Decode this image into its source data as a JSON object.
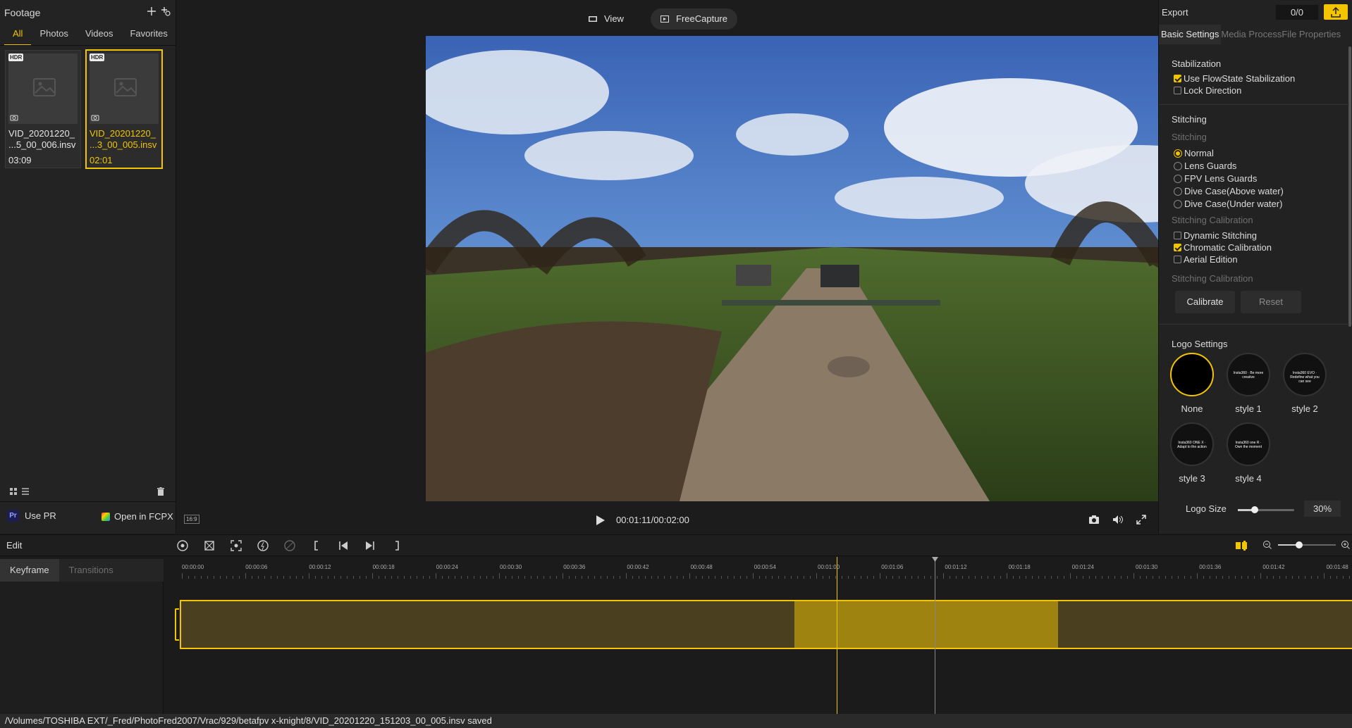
{
  "footage": {
    "title": "Footage",
    "tabs": [
      "All",
      "Photos",
      "Videos",
      "Favorites"
    ],
    "active_tab": "All",
    "items": [
      {
        "badge": "HDR",
        "name": "VID_20201220_\n...5_00_006.insv",
        "duration": "03:09",
        "selected": false
      },
      {
        "badge": "HDR",
        "name": "VID_20201220_\n...3_00_005.insv",
        "duration": "02:01",
        "selected": true
      }
    ],
    "use_pr": "Use PR",
    "pr_badge": "Pr",
    "open_fcpx": "Open in FCPX"
  },
  "viewer": {
    "view_label": "View",
    "freecapture_label": "FreeCapture",
    "aspect_badge": "16:9",
    "timecode": "00:01:11/00:02:00"
  },
  "export": {
    "title": "Export",
    "counter": "0/0",
    "tabs": [
      "Basic Settings",
      "Media Process",
      "File Properties"
    ],
    "stabilization": {
      "title": "Stabilization",
      "use_flowstate": "Use FlowState Stabilization",
      "lock_direction": "Lock Direction"
    },
    "stitching": {
      "title": "Stitching",
      "subtitle": "Stitching",
      "options": [
        "Normal",
        "Lens Guards",
        "FPV Lens Guards",
        "Dive Case(Above water)",
        "Dive Case(Under water)"
      ],
      "selected": "Normal"
    },
    "calibration": {
      "title": "Stitching Calibration",
      "dynamic": "Dynamic Stitching",
      "chromatic": "Chromatic Calibration",
      "aerial": "Aerial Edition",
      "title2": "Stitching Calibration",
      "calibrate": "Calibrate",
      "reset": "Reset"
    },
    "logo": {
      "title": "Logo Settings",
      "styles": [
        "None",
        "style 1",
        "style 2",
        "style 3",
        "style 4"
      ],
      "logo_texts": [
        "",
        "Insta360 · Be more creative",
        "Insta360 EVO · Redefine what you can see",
        "Insta360 ONE X · Adapt to the action",
        "Insta360 one R · Own the moment"
      ],
      "size_label": "Logo Size",
      "size_value": "30%",
      "size_fraction": 0.3
    }
  },
  "edit": {
    "title": "Edit",
    "tabs": [
      "Keyframe",
      "Transitions"
    ],
    "ticks": [
      "00:00:00",
      "00:00:06",
      "00:00:12",
      "00:00:18",
      "00:00:24",
      "00:00:30",
      "00:00:36",
      "00:00:42",
      "00:00:48",
      "00:00:54",
      "00:01:00",
      "00:01:06",
      "00:01:12",
      "00:01:18",
      "00:01:24",
      "00:01:30",
      "00:01:36",
      "00:01:42",
      "00:01:48"
    ]
  },
  "status": "/Volumes/TOSHIBA EXT/_Fred/PhotoFred2007/Vrac/929/betafpv x-knight/8/VID_20201220_151203_00_005.insv saved",
  "colors": {
    "accent": "#f2c500",
    "background": "#1c1c1c",
    "panel": "#232323"
  }
}
